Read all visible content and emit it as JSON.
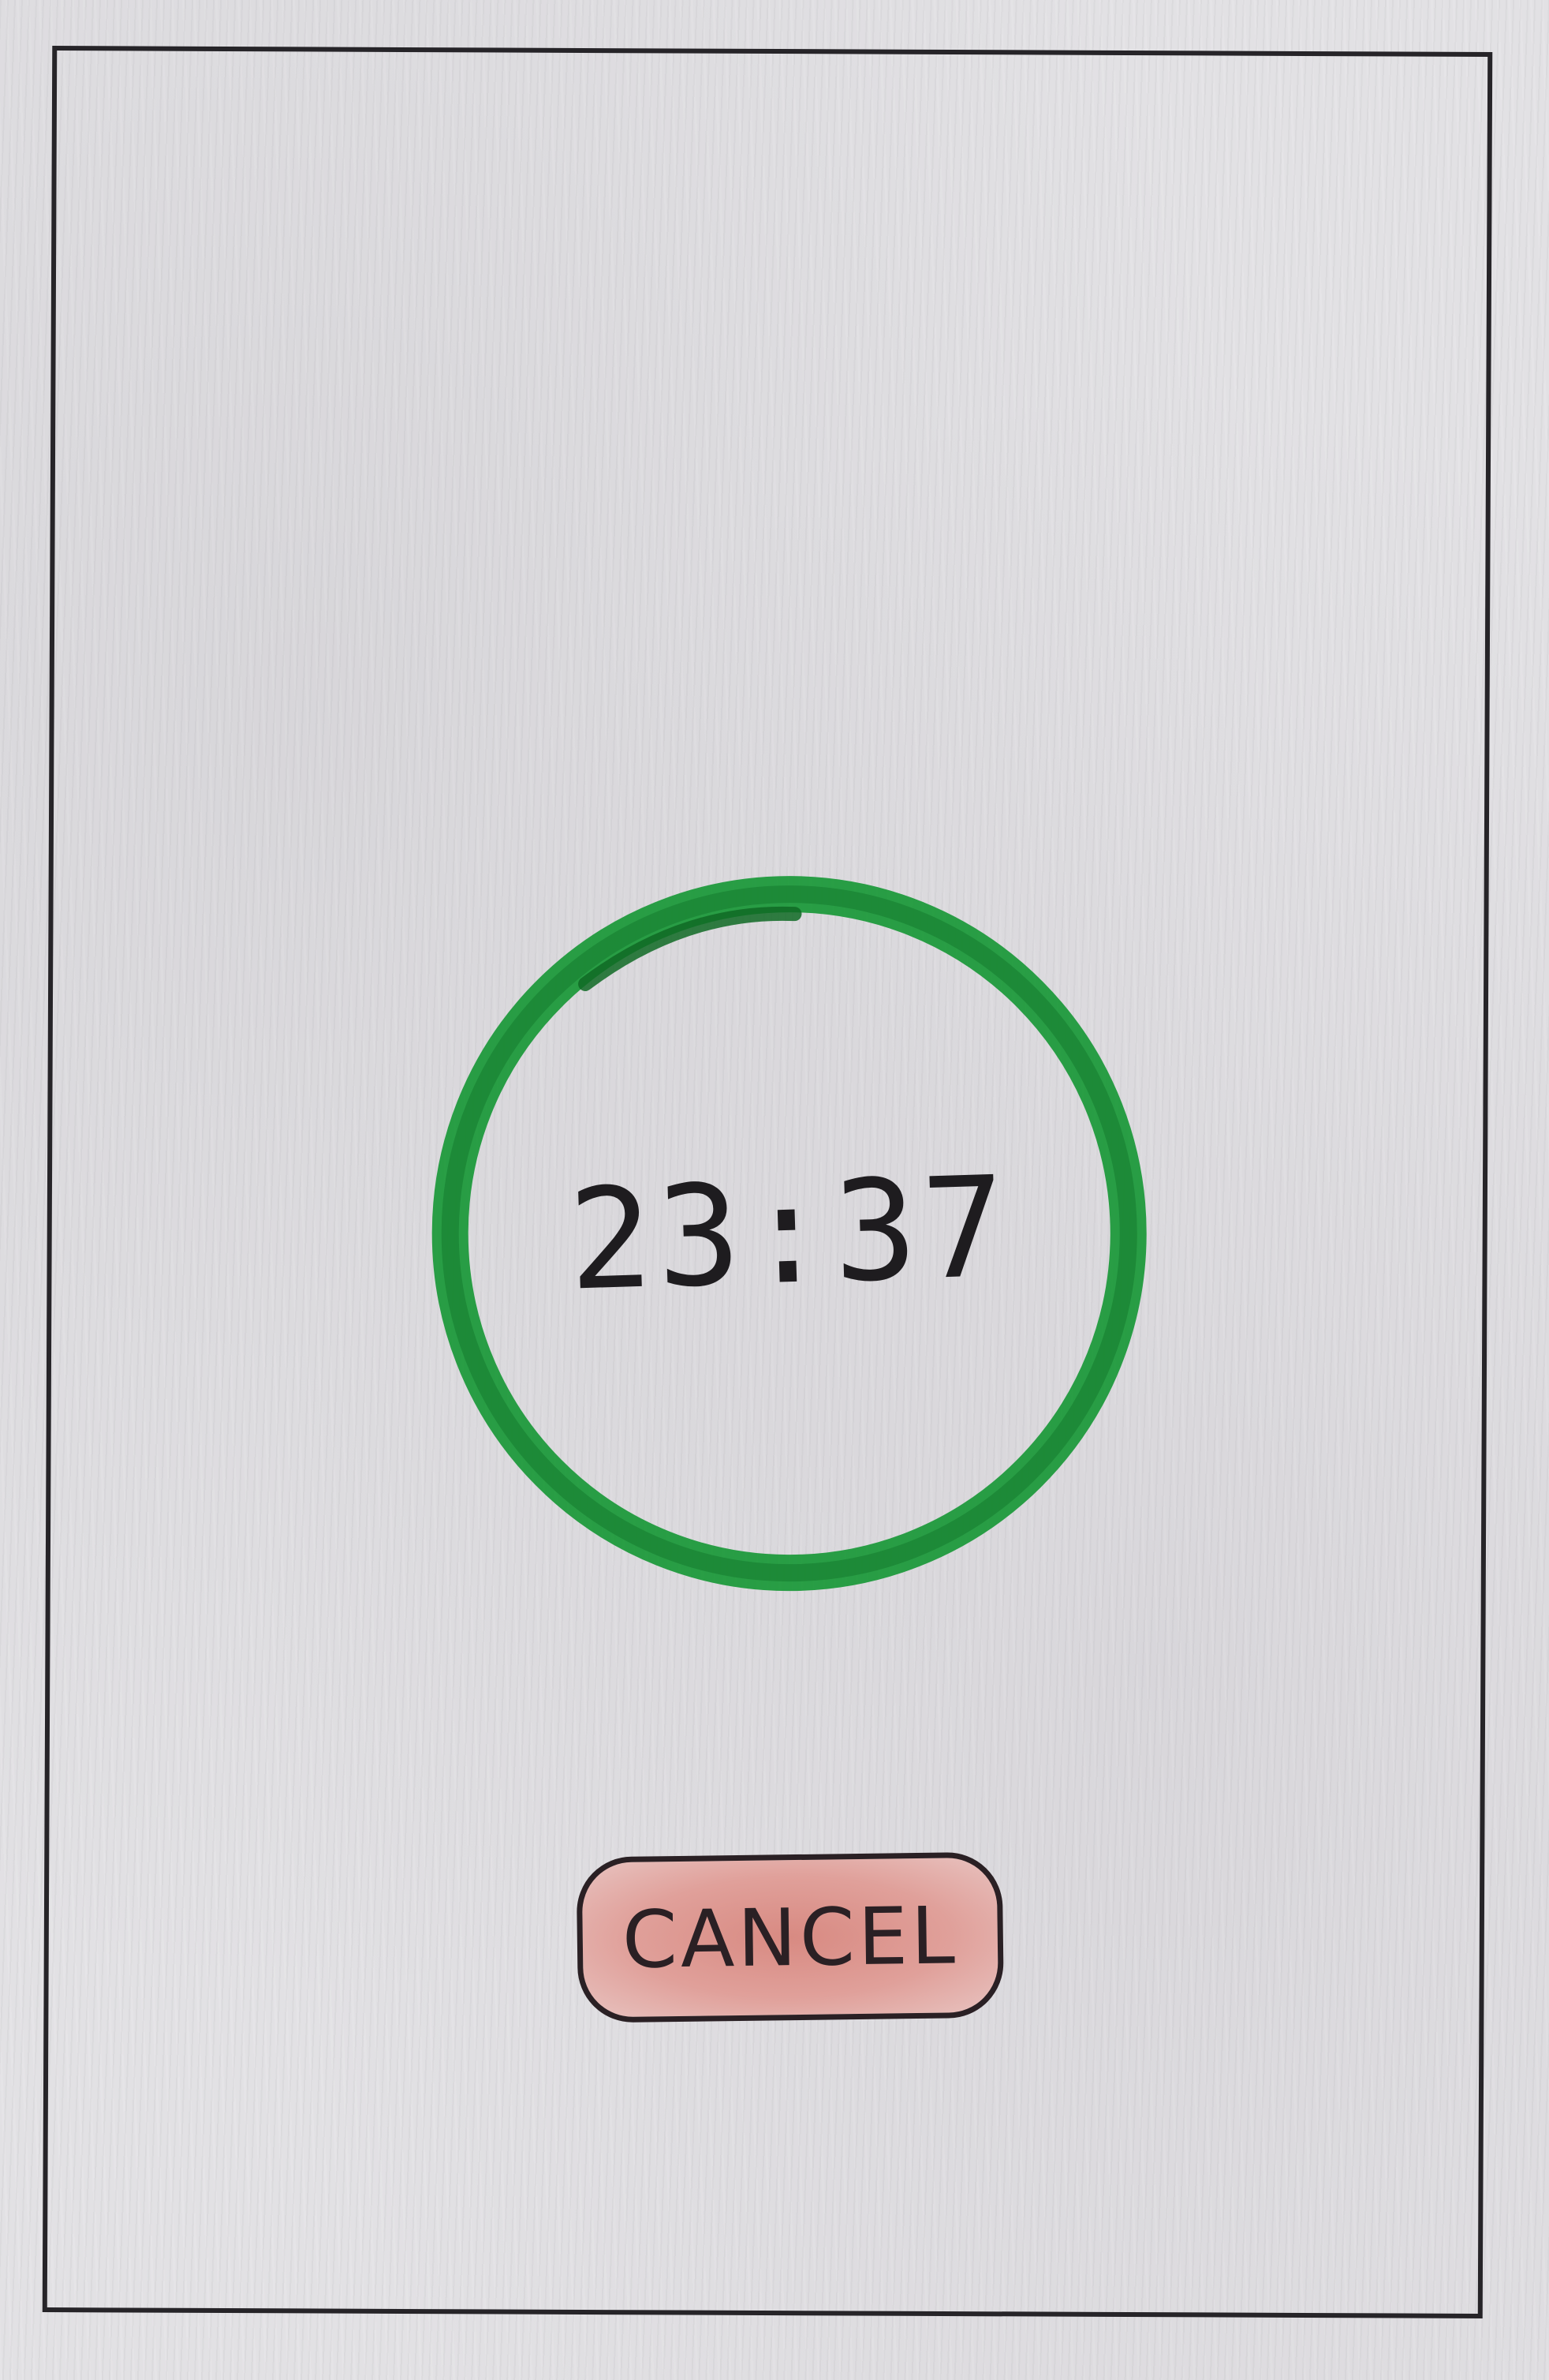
{
  "timer": {
    "time_display": "23:37",
    "ring_color": "#1a8a35"
  },
  "actions": {
    "cancel_label": "CANCEL",
    "cancel_color": "#d88a82"
  }
}
